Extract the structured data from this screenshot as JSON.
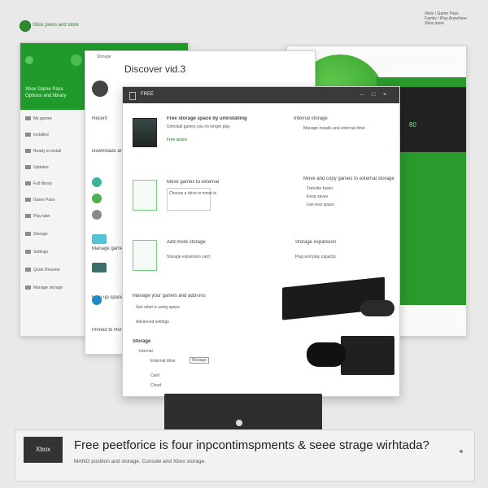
{
  "brand": {
    "text": "Xbox press and store",
    "logo_icon": "xbox-logo-icon",
    "accent": "#1f9a2b"
  },
  "top_right_caption": [
    "Xbox / Game Pass",
    "Family / Play Anywhere",
    "Xbox store"
  ],
  "window_a": {
    "header_lines": [
      "Xbox Game Pass",
      "Options and library"
    ],
    "rows": [
      "My games",
      "Installed",
      "Ready to install",
      "Updates",
      "Full library",
      "Game Pass",
      "Play later",
      "Storage",
      "Settings",
      "Quick Resume",
      "Manage storage"
    ]
  },
  "window_b": {
    "value": "80"
  },
  "window_c": {
    "header": "Storage",
    "title": "Discover vid.3",
    "lines": [
      "Recent",
      "Downloads and more",
      "Manage game installs",
      "Free up space",
      "Pinned to Home"
    ]
  },
  "window_d": {
    "topbar_label": "FREE",
    "controls": [
      "–",
      "□",
      "×"
    ],
    "section1": {
      "title": "Free storage space by uninstalling",
      "detail": "Uninstall games you no longer play",
      "link": "Free space"
    },
    "section1_right": {
      "title": "Internal storage",
      "detail": "Manage installs and external drive"
    },
    "section2": {
      "title": "Move games to external",
      "detail": "Choose a drive to move to"
    },
    "section2_right": {
      "title": "Move and copy games to external storage",
      "items": [
        "Transfer faster",
        "Keep saves",
        "Use less space"
      ]
    },
    "section3": {
      "title": "Add more storage",
      "detail": "Storage expansion card"
    },
    "section3_right": {
      "title": "Storage expansion",
      "detail": "Plug and play capacity"
    },
    "section4": {
      "title": "Manage your games and add-ons",
      "detail": "See what is using space",
      "sub": "Advanced settings"
    },
    "section5": {
      "title": "Storage",
      "items": [
        "Internal",
        "External drive",
        "Card",
        "Cloud"
      ],
      "chip": "Manage"
    }
  },
  "banner": {
    "badge": "Xbox",
    "headline": "Free peetforice is four inpcontimspments & seee strage wirhtada?",
    "sub": "MANG position and storage. Console and Xbox storage."
  }
}
